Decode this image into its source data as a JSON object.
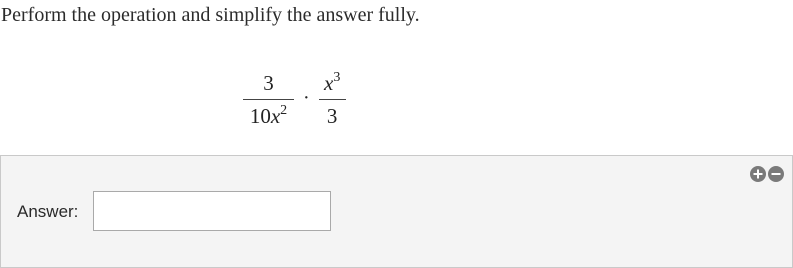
{
  "question": {
    "prompt": "Perform the operation and simplify the answer fully."
  },
  "expression": {
    "frac1_num": "3",
    "frac1_den_coef": "10",
    "frac1_den_var": "x",
    "frac1_den_exp": "2",
    "operator": "·",
    "frac2_num_var": "x",
    "frac2_num_exp": "3",
    "frac2_den": "3"
  },
  "answer": {
    "label": "Answer:",
    "value": ""
  },
  "controls": {
    "zoom_in_icon": "plus-circle-icon",
    "zoom_out_icon": "minus-circle-icon"
  }
}
